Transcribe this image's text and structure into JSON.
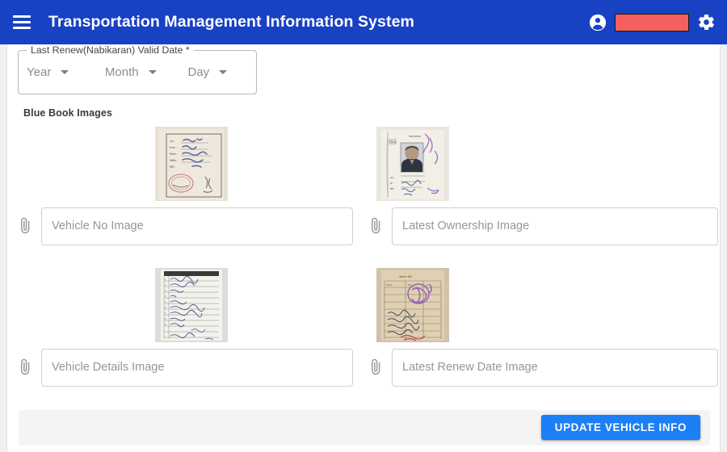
{
  "header": {
    "menu_icon": "hamburger-menu-icon",
    "title": "Transportation Management Information System",
    "account_icon": "account-circle-icon",
    "user_name_redacted": "",
    "settings_icon": "gear-icon"
  },
  "form": {
    "date_field": {
      "legend": "Last Renew(Nabikaran) Valid Date *",
      "year": {
        "value": "Year",
        "options": [
          "Year"
        ]
      },
      "month": {
        "value": "Month",
        "options": [
          "Month"
        ]
      },
      "day": {
        "value": "Day",
        "options": [
          "Day"
        ]
      }
    },
    "section_label": "Blue Book Images",
    "images": [
      {
        "name": "vehicle-no-image",
        "placeholder": "Vehicle No Image",
        "value": "",
        "attach_icon": "paperclip-icon",
        "thumbnail_alt": "Scanned blue book page with handwritten Devanagari text and red stamp"
      },
      {
        "name": "latest-ownership-image",
        "placeholder": "Latest Ownership Image",
        "value": "",
        "attach_icon": "paperclip-icon",
        "thumbnail_alt": "Scanned ownership page with blurred passport photo and purple stamp"
      },
      {
        "name": "vehicle-details-image",
        "placeholder": "Vehicle Details Image",
        "value": "",
        "attach_icon": "paperclip-icon",
        "thumbnail_alt": "Scanned lined details page with handwritten entries"
      },
      {
        "name": "latest-renew-date-image",
        "placeholder": "Latest Renew Date Image",
        "value": "",
        "attach_icon": "paperclip-icon",
        "thumbnail_alt": "Scanned tan renewal record page with purple stamp"
      }
    ]
  },
  "footer": {
    "submit_label": "UPDATE VEHICLE INFO"
  },
  "colors": {
    "appbar": "#1841c4",
    "primary_button": "#1b7ff5",
    "redaction": "#f4615c",
    "footer_bar": "#f4f4f4"
  }
}
